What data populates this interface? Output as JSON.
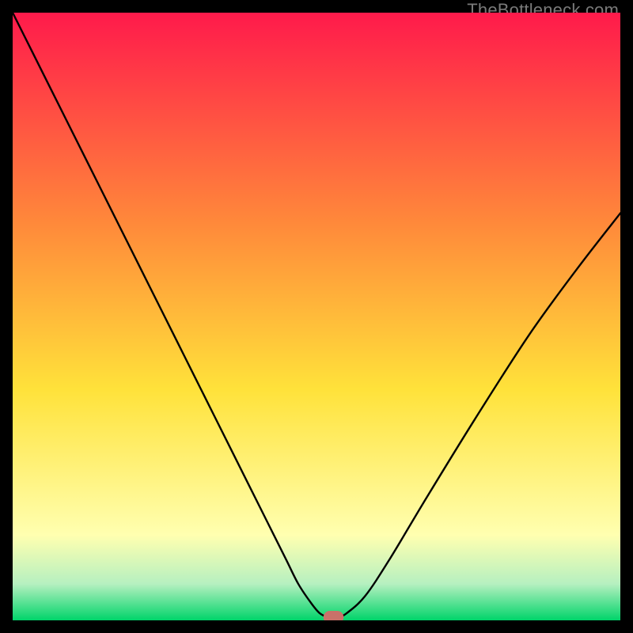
{
  "watermark": "TheBottleneck.com",
  "colors": {
    "border": "#000000",
    "curve": "#000000",
    "marker_fill": "#c97169",
    "marker_stroke": "#c97169",
    "grad_top": "#ff1a4b",
    "grad_mid_upper": "#ff8a3a",
    "grad_mid": "#ffe23a",
    "grad_pale": "#ffffb0",
    "grad_green_pale": "#b6f0c0",
    "grad_green": "#00d46a"
  },
  "chart_data": {
    "type": "line",
    "title": "",
    "xlabel": "",
    "ylabel": "",
    "xlim": [
      0,
      100
    ],
    "ylim": [
      0,
      100
    ],
    "x": [
      0,
      3,
      6,
      9,
      12,
      15,
      18,
      21,
      24,
      27,
      30,
      33,
      36,
      39,
      42,
      45,
      47,
      49,
      50.5,
      52,
      53.5,
      55,
      58,
      62,
      68,
      76,
      85,
      93,
      100
    ],
    "values": [
      100,
      94,
      88,
      82,
      76,
      70,
      64,
      58,
      52,
      46,
      40,
      34,
      28,
      22,
      16,
      10,
      6,
      3,
      1.2,
      0.5,
      0.5,
      1.2,
      4,
      10,
      20,
      33,
      47,
      58,
      67
    ],
    "marker": {
      "x": 52.8,
      "y": 0.5,
      "rx": 1.6,
      "ry": 1.0
    },
    "annotations": []
  }
}
